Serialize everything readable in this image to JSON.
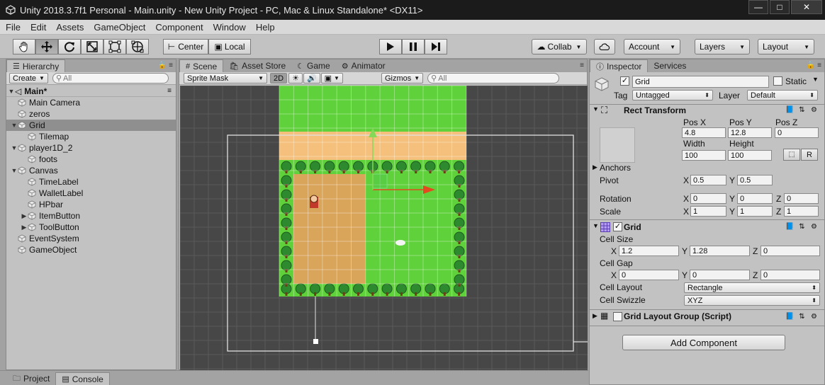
{
  "window": {
    "title": "Unity 2018.3.7f1 Personal - Main.unity - New Unity Project - PC, Mac & Linux Standalone* <DX11>",
    "minimize": "—",
    "maximize": "□",
    "close": "✕"
  },
  "menu": [
    "File",
    "Edit",
    "Assets",
    "GameObject",
    "Component",
    "Window",
    "Help"
  ],
  "toolbar": {
    "tools": [
      "hand-tool",
      "move-tool",
      "rotate-tool",
      "scale-tool",
      "rect-tool",
      "transform-tool"
    ],
    "pivot_label": "Center",
    "space_label": "Local",
    "collab_label": "Collab",
    "account_label": "Account",
    "layers_label": "Layers",
    "layout_label": "Layout"
  },
  "hierarchy": {
    "tab_label": "Hierarchy",
    "create_label": "Create",
    "search_placeholder": "All",
    "scene_name": "Main*",
    "items": [
      {
        "label": "Main Camera",
        "depth": 1,
        "arrow": ""
      },
      {
        "label": "zeros",
        "depth": 1,
        "arrow": ""
      },
      {
        "label": "Grid",
        "depth": 1,
        "arrow": "▼",
        "selected": true
      },
      {
        "label": "Tilemap",
        "depth": 2,
        "arrow": ""
      },
      {
        "label": "player1D_2",
        "depth": 1,
        "arrow": "▼"
      },
      {
        "label": "foots",
        "depth": 2,
        "arrow": ""
      },
      {
        "label": "Canvas",
        "depth": 1,
        "arrow": "▼"
      },
      {
        "label": "TimeLabel",
        "depth": 2,
        "arrow": ""
      },
      {
        "label": "WalletLabel",
        "depth": 2,
        "arrow": ""
      },
      {
        "label": "HPbar",
        "depth": 2,
        "arrow": ""
      },
      {
        "label": "ItemButton",
        "depth": 2,
        "arrow": "▶"
      },
      {
        "label": "ToolButton",
        "depth": 2,
        "arrow": "▶"
      },
      {
        "label": "EventSystem",
        "depth": 1,
        "arrow": ""
      },
      {
        "label": "GameObject",
        "depth": 1,
        "arrow": ""
      }
    ]
  },
  "scene": {
    "tabs": [
      "Scene",
      "Asset Store",
      "Game",
      "Animator"
    ],
    "draw_mode": "Sprite Mask",
    "mode_2d": "2D",
    "gizmos_label": "Gizmos",
    "search_placeholder": "All"
  },
  "inspector": {
    "tabs": [
      "Inspector",
      "Services"
    ],
    "object_name": "Grid",
    "static_label": "Static",
    "tag_label": "Tag",
    "tag_value": "Untagged",
    "layer_label": "Layer",
    "layer_value": "Default",
    "rect_transform": {
      "title": "Rect Transform",
      "pos_x_label": "Pos X",
      "pos_y_label": "Pos Y",
      "pos_z_label": "Pos Z",
      "pos_x": "4.8",
      "pos_y": "12.8",
      "pos_z": "0",
      "width_label": "Width",
      "height_label": "Height",
      "width": "100",
      "height": "100",
      "anchors_label": "Anchors",
      "pivot_label": "Pivot",
      "pivot_x": "0.5",
      "pivot_y": "0.5",
      "rotation_label": "Rotation",
      "rot_x": "0",
      "rot_y": "0",
      "rot_z": "0",
      "scale_label": "Scale",
      "scale_x": "1",
      "scale_y": "1",
      "scale_z": "1",
      "x": "X",
      "y": "Y",
      "z": "Z",
      "r_button": "R"
    },
    "grid": {
      "title": "Grid",
      "cell_size_label": "Cell Size",
      "cell_size": {
        "x": "1.2",
        "y": "1.28",
        "z": "0"
      },
      "cell_gap_label": "Cell Gap",
      "cell_gap": {
        "x": "0",
        "y": "0",
        "z": "0"
      },
      "cell_layout_label": "Cell Layout",
      "cell_layout": "Rectangle",
      "cell_swizzle_label": "Cell Swizzle",
      "cell_swizzle": "XYZ"
    },
    "grid_layout_group": "Grid Layout Group (Script)",
    "add_component": "Add Component"
  },
  "bottom": {
    "tabs": [
      "Project",
      "Console"
    ]
  },
  "colors": {
    "grass": "#5fd13a",
    "path": "#f4c07c",
    "dirt": "#d9a55b",
    "tree": "#2e8a2e",
    "scene_bg": "#474747"
  }
}
